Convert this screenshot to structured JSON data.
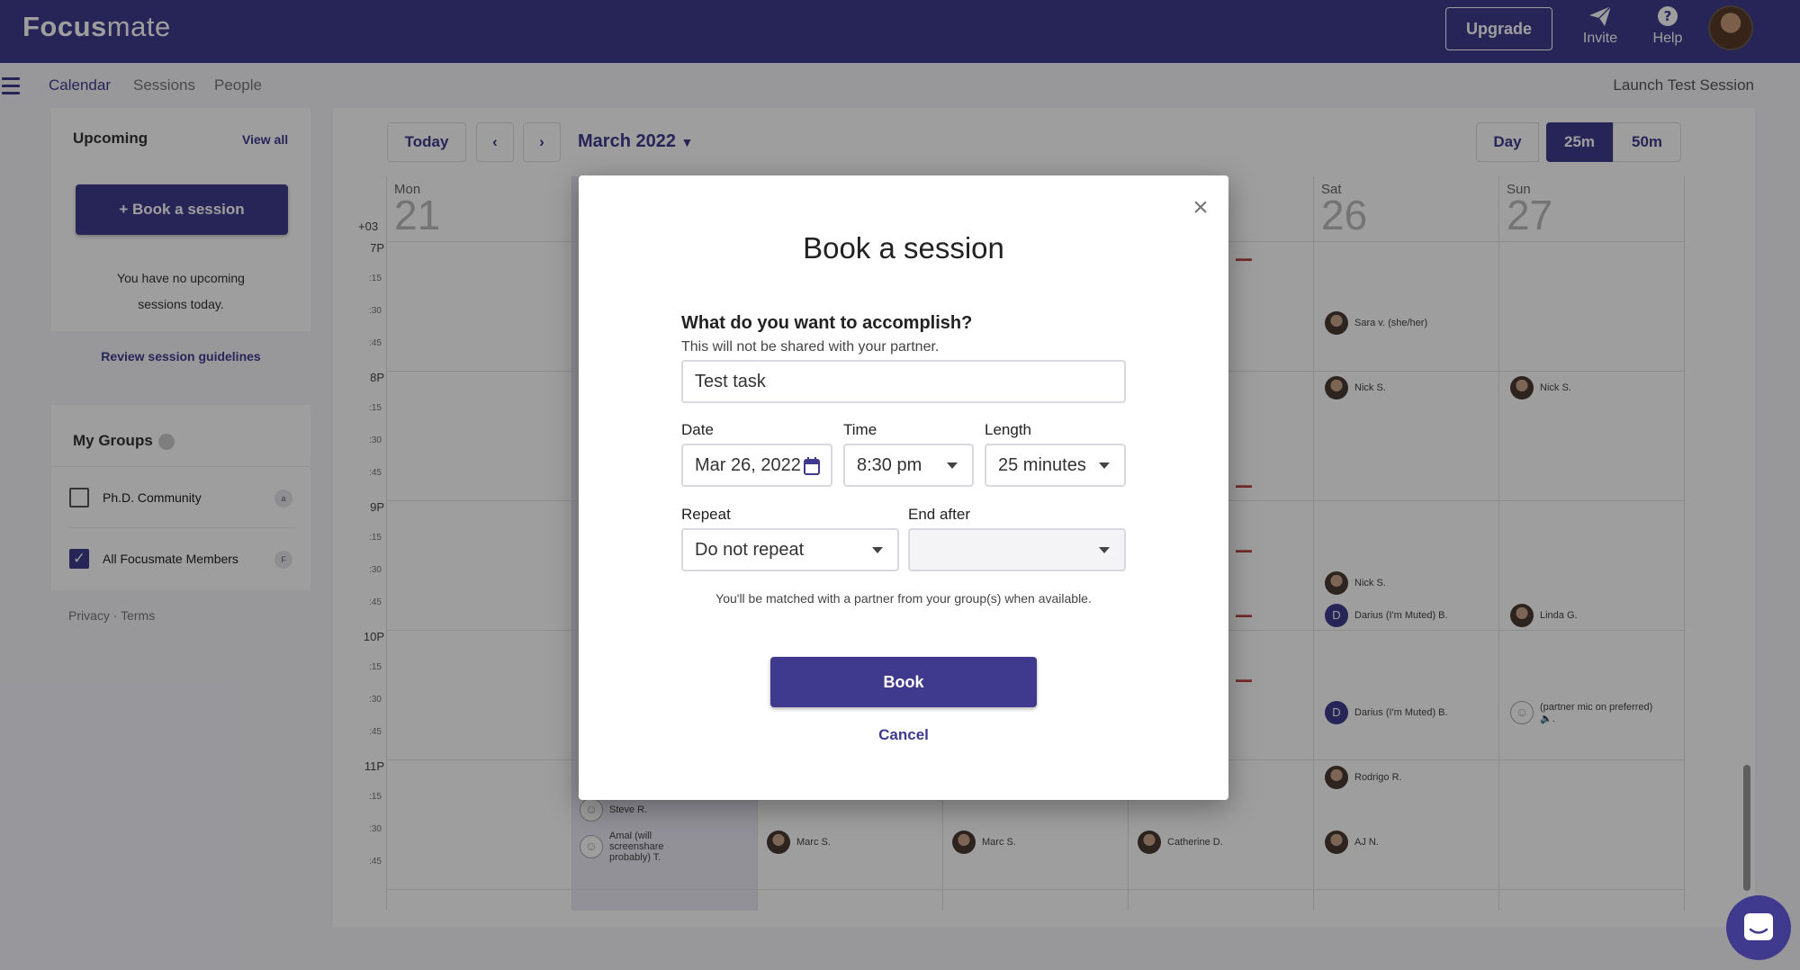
{
  "app": {
    "logo_bold": "Focus",
    "logo_light": "mate",
    "upgrade": "Upgrade",
    "invite": "Invite",
    "help": "Help"
  },
  "nav": {
    "tabs": [
      "Calendar",
      "Sessions",
      "People"
    ],
    "launch_test": "Launch Test Session"
  },
  "sidebar": {
    "upcoming_title": "Upcoming",
    "view_all": "View all",
    "book_session": "+ Book a session",
    "no_upcoming_line1": "You have no upcoming",
    "no_upcoming_line2": "sessions today.",
    "guidelines": "Review session guidelines",
    "groups_title": "My Groups",
    "groups": [
      {
        "name": "Ph.D. Community",
        "checked": false,
        "badge": "a"
      },
      {
        "name": "All Focusmate Members",
        "checked": true,
        "badge": "F"
      }
    ],
    "footer": "Privacy · Terms"
  },
  "calendar": {
    "today": "Today",
    "month": "March 2022",
    "views": [
      "Day",
      "25m",
      "50m"
    ],
    "active_view": "25m",
    "timezone": "+03",
    "days": [
      {
        "name": "Mon",
        "num": "21"
      },
      {
        "name": "",
        "num": ""
      },
      {
        "name": "",
        "num": ""
      },
      {
        "name": "",
        "num": ""
      },
      {
        "name": "",
        "num": ""
      },
      {
        "name": "Sat",
        "num": "26"
      },
      {
        "name": "Sun",
        "num": "27"
      }
    ],
    "hours": [
      "7P",
      "8P",
      "9P",
      "10P",
      "11P"
    ],
    "quarters": [
      ":15",
      ":30",
      ":45"
    ],
    "partners": [
      {
        "name": "Sara v. (she/her)"
      },
      {
        "name": "Nick S."
      },
      {
        "name": "Nick S."
      },
      {
        "name": "Nick S."
      },
      {
        "name": "Darius (I'm Muted) B.",
        "initial": "D"
      },
      {
        "name": "Linda G."
      },
      {
        "name": "Darius (I'm Muted) B.",
        "initial": "D"
      },
      {
        "name": "(partner mic on preferred)",
        "extra": "🔈."
      },
      {
        "name": "Rodrigo R."
      },
      {
        "name": "AJ N."
      },
      {
        "name": "Steve R."
      },
      {
        "name": "Amal (will screenshare probably) T."
      },
      {
        "name": "Marc S."
      },
      {
        "name": "Marc S."
      },
      {
        "name": "Catherine D."
      }
    ]
  },
  "modal": {
    "title": "Book a session",
    "question": "What do you want to accomplish?",
    "question_sub": "This will not be shared with your partner.",
    "task_value": "Test task",
    "date_label": "Date",
    "date_value": "Mar 26, 2022",
    "time_label": "Time",
    "time_value": "8:30 pm",
    "length_label": "Length",
    "length_value": "25 minutes",
    "repeat_label": "Repeat",
    "repeat_value": "Do not repeat",
    "end_after_label": "End after",
    "end_after_value": "",
    "note": "You'll be matched with a partner from your group(s) when available.",
    "book": "Book",
    "cancel": "Cancel"
  },
  "colors": {
    "brand": "#3f3a8e",
    "background": "#f6f6fb"
  }
}
